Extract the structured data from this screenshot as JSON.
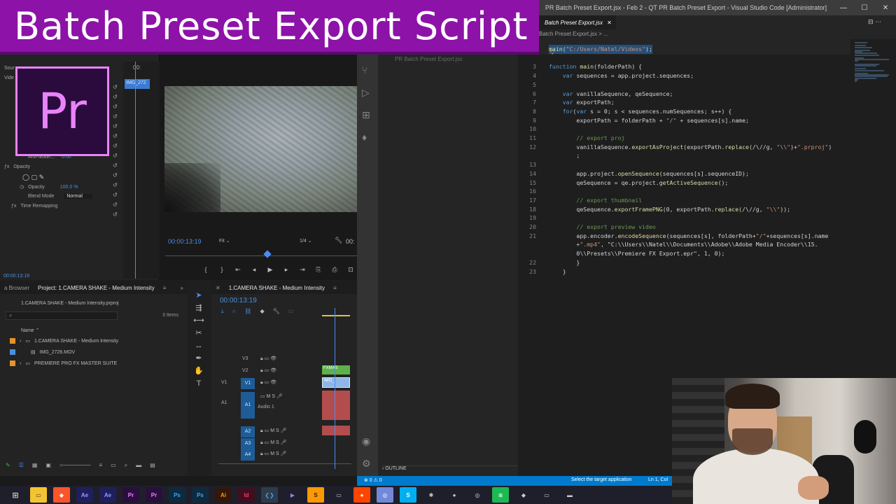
{
  "banner": {
    "title": "Batch Preset Export Script"
  },
  "vscode": {
    "window_title": "PR Batch Preset Export.jsx - Feb 2 - QT PR Batch Preset Export - Visual Studio Code [Administrator]",
    "tab_label": "Batch Preset Export.jsx",
    "breadcrumb": "Batch Preset Export.jsx > ...",
    "sidebar_title": "PR Batch Preset Export.jsx",
    "outline_label": "OUTLINE",
    "code_lines": [
      {
        "num": "",
        "text": "main(\"C:/Users/Natel/Videos\");"
      },
      {
        "num": "",
        "text": ""
      },
      {
        "num": "3",
        "text": "function main(folderPath) {"
      },
      {
        "num": "4",
        "text": "    var sequences = app.project.sequences;"
      },
      {
        "num": "5",
        "text": ""
      },
      {
        "num": "6",
        "text": "    var vanillaSequence, qeSequence;"
      },
      {
        "num": "7",
        "text": "    var exportPath;"
      },
      {
        "num": "8",
        "text": "    for(var s = 0; s < sequences.numSequences; s++) {"
      },
      {
        "num": "9",
        "text": "        exportPath = folderPath + \"/\" + sequences[s].name;"
      },
      {
        "num": "10",
        "text": ""
      },
      {
        "num": "11",
        "text": "        // export proj"
      },
      {
        "num": "12",
        "text": "        vanillaSequence.exportAsProject(exportPath.replace(/\\//g, \"\\\\\")+\".prproj\")"
      },
      {
        "num": "",
        "text": "        ;"
      },
      {
        "num": "13",
        "text": ""
      },
      {
        "num": "14",
        "text": "        app.project.openSequence(sequences[s].sequenceID);"
      },
      {
        "num": "15",
        "text": "        qeSequence = qe.project.getActiveSequence();"
      },
      {
        "num": "16",
        "text": ""
      },
      {
        "num": "17",
        "text": "        // export thumbnail"
      },
      {
        "num": "18",
        "text": "        qeSequence.exportFramePNG(0, exportPath.replace(/\\//g, \"\\\\\"));"
      },
      {
        "num": "19",
        "text": ""
      },
      {
        "num": "20",
        "text": "        // export preview video"
      },
      {
        "num": "21",
        "text": "        app.encoder.encodeSequence(sequences[s], folderPath+\"/\"+sequences[s].name"
      },
      {
        "num": "",
        "text": "        +\".mp4\", \"C:\\\\Users\\\\Natel\\\\Documents\\\\Adobe\\\\Adobe Media Encoder\\\\15."
      },
      {
        "num": "",
        "text": "        0\\\\Presets\\\\Premiere FX Export.epr\", 1, 0);"
      },
      {
        "num": "22",
        "text": "        }"
      },
      {
        "num": "23",
        "text": "    }"
      }
    ],
    "status": {
      "errors": "⊗ 0 ⚠ 0",
      "message": "Select the target application",
      "position": "Ln 1, Col"
    },
    "colors": {
      "accent": "#007acc",
      "keyword": "#569cd6",
      "comment": "#6a9955",
      "string": "#ce9178",
      "function": "#dcdcaa",
      "variable": "#9cdcfe"
    }
  },
  "premiere": {
    "logo_text": "Pr",
    "effects": {
      "rows": [
        {
          "label": "Sour",
          "value": ""
        },
        {
          "label": "Vide",
          "value": ""
        },
        {
          "label": "Anti-flicker...",
          "value": "0.00"
        },
        {
          "label": "Opacity",
          "value": ""
        },
        {
          "label": "Opacity",
          "value": "100.0 %"
        },
        {
          "label": "Blend Mode",
          "value": "Normal"
        },
        {
          "label": "Time Remapping",
          "value": ""
        }
      ],
      "mini_clip": "IMG_272",
      "mini_time": "00:",
      "timecode": "00:00:13:19"
    },
    "monitor": {
      "timecode": "00:00:13:19",
      "fit": "Fit",
      "resolution": "1/4",
      "timecode_right": "00:"
    },
    "project": {
      "tabs": [
        "a Browser",
        "Project: 1.CAMERA SHAKE - Medium Intensity"
      ],
      "file": "1.CAMERA SHAKE - Medium Intensity.prproj",
      "items_count": "3 Items",
      "column_name": "Name",
      "items": [
        {
          "name": "1.CAMERA SHAKE - Medium Intensity",
          "color": "#e8922c"
        },
        {
          "name": "IMG_2726.MOV",
          "color": "#4a90d9"
        },
        {
          "name": "PREMIERE PRO FX MASTER SUITE",
          "color": "#e8922c"
        }
      ]
    },
    "timeline": {
      "tab": "1.CAMERA SHAKE - Medium Intensity",
      "timecode": "00:00:13:19",
      "tracks": [
        {
          "name": "V3",
          "label": ""
        },
        {
          "name": "V2",
          "label": ""
        },
        {
          "name": "V1",
          "label": "V1"
        },
        {
          "name": "A1",
          "label": "Audio 1"
        },
        {
          "name": "A2",
          "label": ""
        },
        {
          "name": "A3",
          "label": ""
        },
        {
          "name": "A4",
          "label": ""
        }
      ],
      "clips": [
        {
          "label": "FXMAS"
        },
        {
          "label": "IMG_"
        }
      ]
    }
  },
  "taskbar": {
    "icons": [
      "Ae",
      "Ae",
      "Pr",
      "Pr",
      "Ps",
      "Ps",
      "Ai",
      "Id"
    ]
  }
}
